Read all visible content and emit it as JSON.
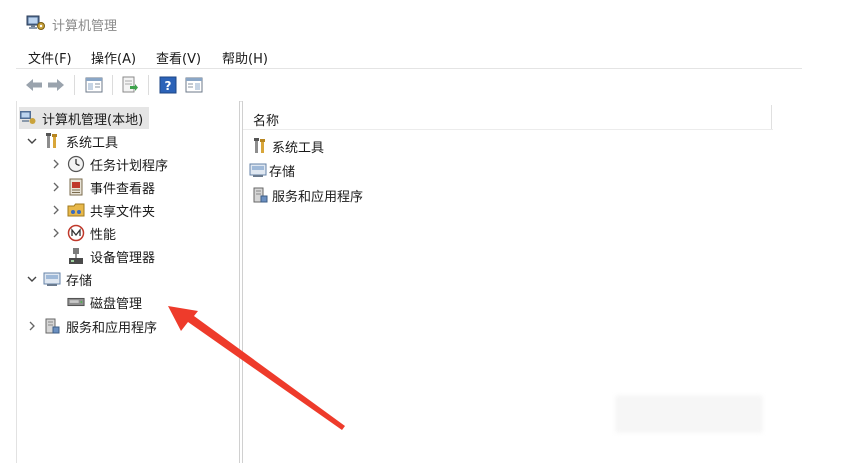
{
  "window": {
    "title": "计算机管理"
  },
  "menu": [
    "文件(F)",
    "操作(A)",
    "查看(V)",
    "帮助(H)"
  ],
  "toolbar": {
    "buttons": [
      "back-arrow-icon",
      "forward-arrow-icon",
      "show-hide-tree-icon",
      "export-list-icon",
      "help-icon",
      "properties-icon"
    ]
  },
  "tree": {
    "root": "计算机管理(本地)",
    "system_tools": "系统工具",
    "task_scheduler": "任务计划程序",
    "event_viewer": "事件查看器",
    "shared_folders": "共享文件夹",
    "performance": "性能",
    "device_manager": "设备管理器",
    "storage": "存储",
    "disk_management": "磁盘管理",
    "services_apps": "服务和应用程序"
  },
  "list": {
    "column_name": "名称",
    "items": [
      "系统工具",
      "存储",
      "服务和应用程序"
    ]
  },
  "colors": {
    "arrow": "#ee3b2b",
    "selection": "#e5e5e5"
  }
}
